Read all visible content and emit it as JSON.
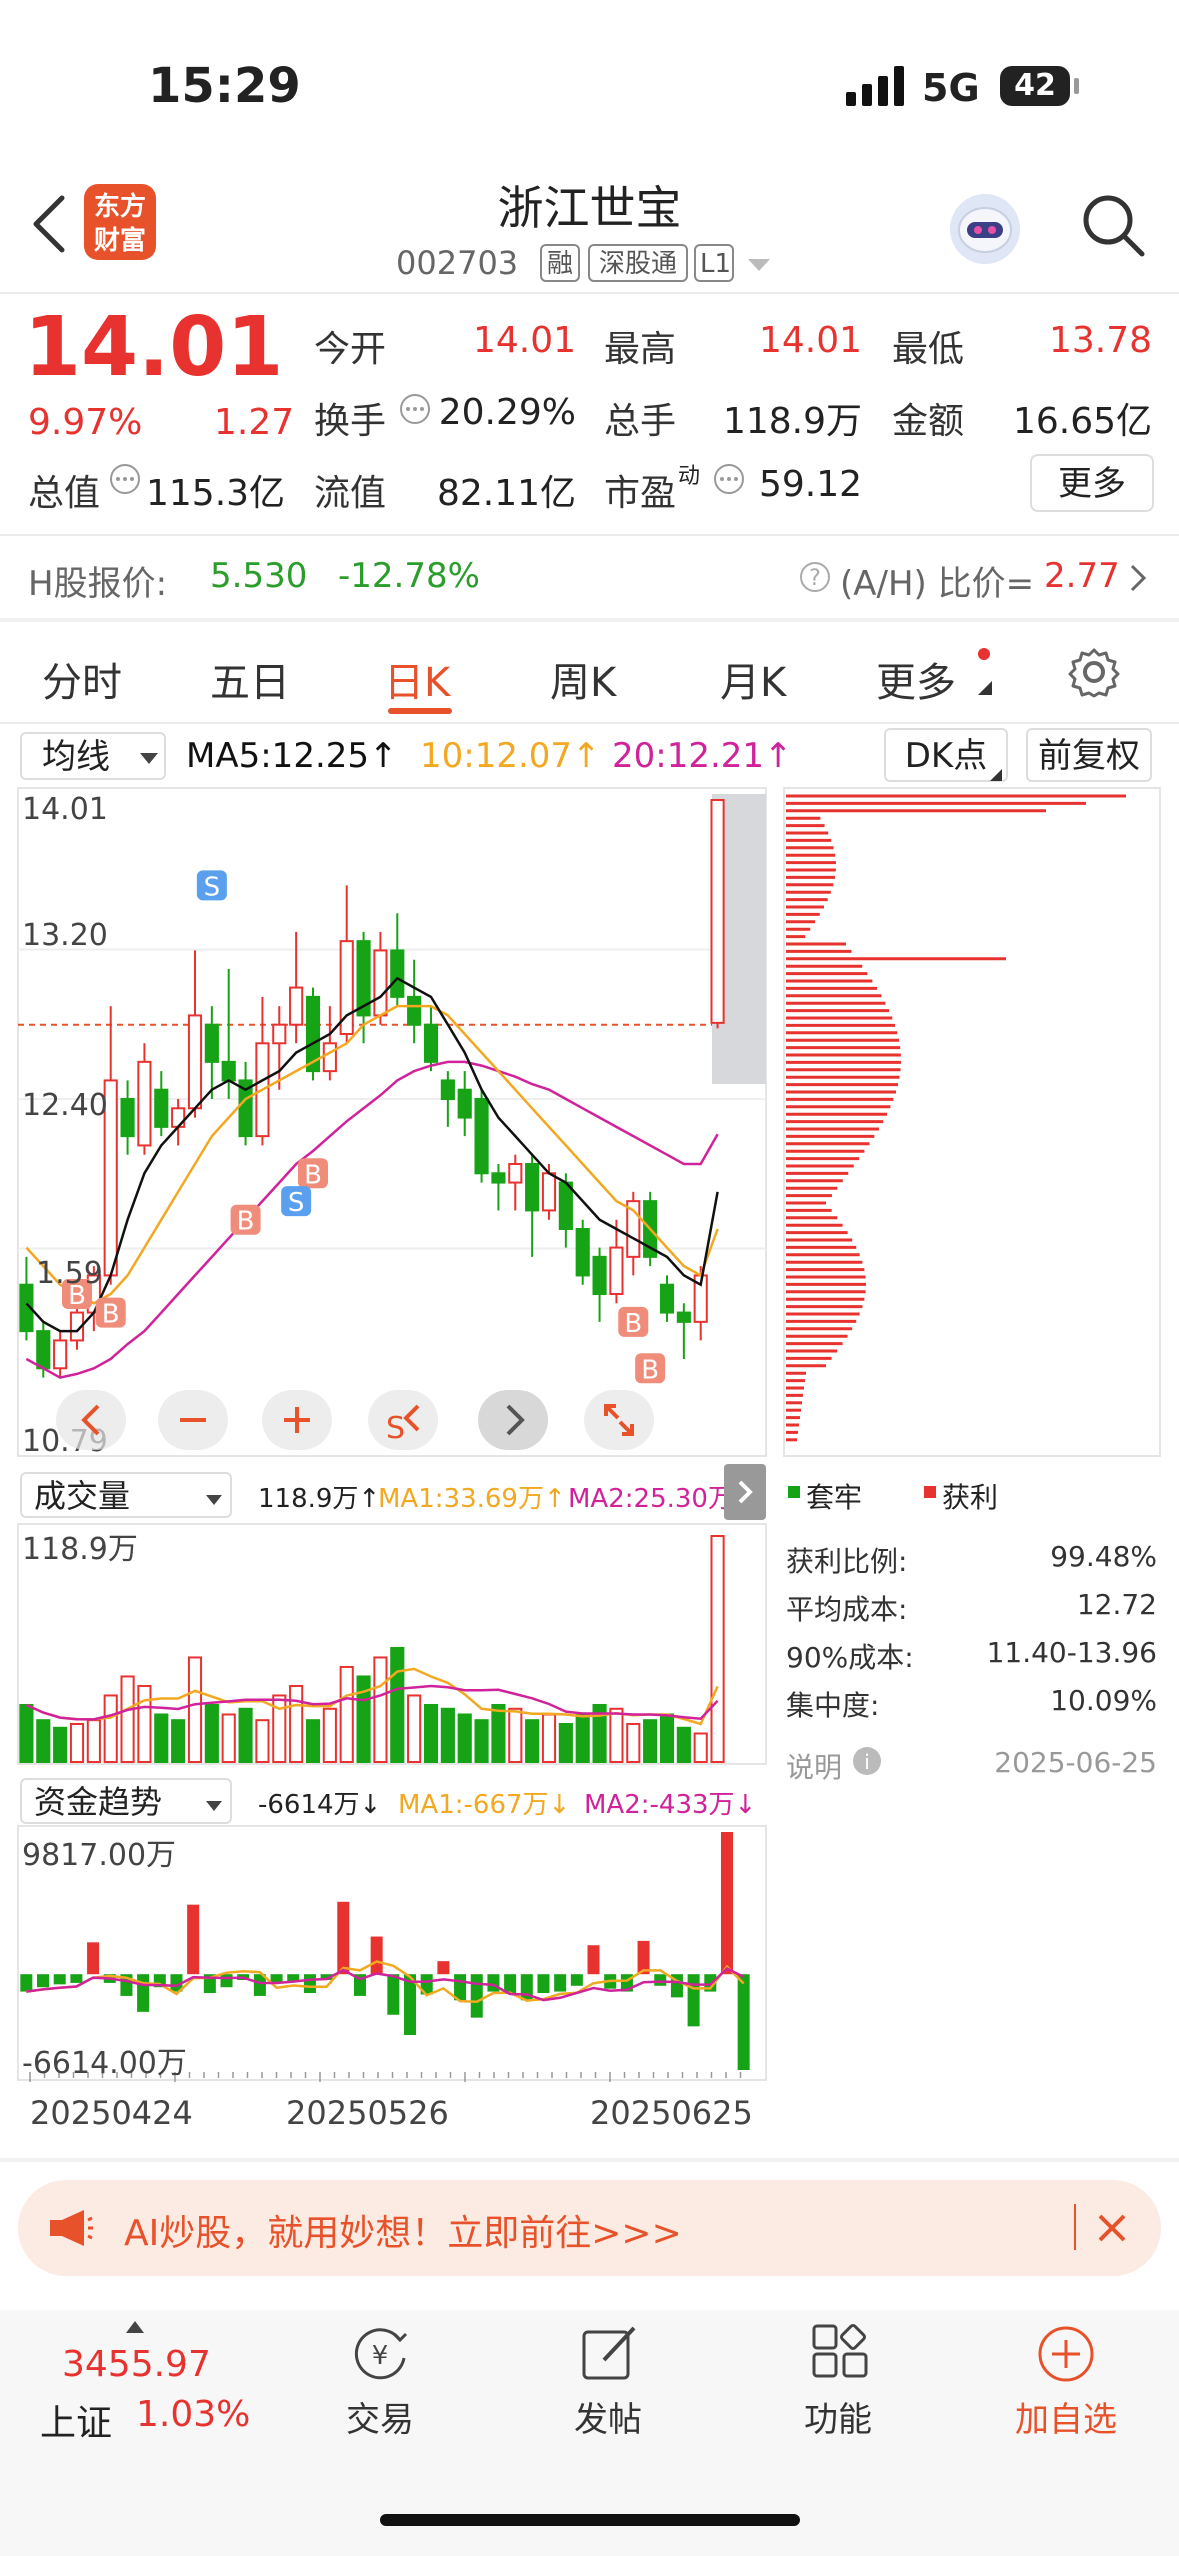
{
  "status_bar": {
    "time": "15:29",
    "network": "5G",
    "battery": "42"
  },
  "header": {
    "logo_text": "东方\n财富",
    "logo_line1": "东方",
    "logo_line2": "财富",
    "title": "浙江世宝",
    "code": "002703",
    "tags": [
      "融",
      "深股通",
      "L1"
    ]
  },
  "quote": {
    "price": "14.01",
    "change_pct": "9.97%",
    "change": "1.27",
    "rows": [
      [
        {
          "label": "今开",
          "value": "14.01",
          "color": "red"
        },
        {
          "label": "最高",
          "value": "14.01",
          "color": "red"
        },
        {
          "label": "最低",
          "value": "13.78",
          "color": "red"
        }
      ],
      [
        {
          "label": "换手",
          "value": "20.29%",
          "color": "dark"
        },
        {
          "label": "总手",
          "value": "118.9万",
          "color": "dark"
        },
        {
          "label": "金额",
          "value": "16.65亿",
          "color": "dark"
        }
      ],
      [
        {
          "label": "总值",
          "value": "115.3亿",
          "color": "dark"
        },
        {
          "label": "流值",
          "value": "82.11亿",
          "color": "dark"
        },
        {
          "label": "市盈",
          "value": "59.12",
          "color": "dark"
        }
      ]
    ],
    "pe_sup": "动",
    "more_label": "更多"
  },
  "hshare": {
    "label": "H股报价:",
    "price": "5.530",
    "pct": "-12.78%",
    "ratio_label": "(A/H) 比价=",
    "ratio": "2.77"
  },
  "tabs": [
    "分时",
    "五日",
    "日K",
    "周K",
    "月K",
    "更多"
  ],
  "active_tab": "日K",
  "ma_bar": {
    "selector": "均线",
    "ma5": "MA5:12.25↑",
    "ma10": "10:12.07↑",
    "ma20": "20:12.21↑",
    "dk": "DK点",
    "adjust": "前复权"
  },
  "colors": {
    "up": "#e8322f",
    "down": "#16a316",
    "ma5": "#111111",
    "ma10": "#f2a820",
    "ma20": "#d0229a",
    "accent": "#e8522a"
  },
  "chart_data": [
    {
      "type": "candlestick",
      "y_ticks": [
        "14.01",
        "13.20",
        "12.40",
        "1.59",
        "10.79"
      ],
      "ylim": [
        10.79,
        14.01
      ],
      "x_ticks": [
        "20250424",
        "20250526",
        "20250625"
      ],
      "candles": [
        [
          11.4,
          11.15,
          11.55,
          11.1
        ],
        [
          11.15,
          10.95,
          11.2,
          10.9
        ],
        [
          10.95,
          11.1,
          11.15,
          10.9
        ],
        [
          11.1,
          11.25,
          11.3,
          11.05
        ],
        [
          11.25,
          11.45,
          11.5,
          11.15
        ],
        [
          11.45,
          12.5,
          12.9,
          11.4
        ],
        [
          12.4,
          12.2,
          12.5,
          12.1
        ],
        [
          12.15,
          12.6,
          12.7,
          12.1
        ],
        [
          12.45,
          12.25,
          12.55,
          12.2
        ],
        [
          12.25,
          12.35,
          12.4,
          12.15
        ],
        [
          12.35,
          12.85,
          13.2,
          12.3
        ],
        [
          12.8,
          12.6,
          12.9,
          12.4
        ],
        [
          12.6,
          12.5,
          13.1,
          12.4
        ],
        [
          12.5,
          12.2,
          12.6,
          12.15
        ],
        [
          12.2,
          12.7,
          12.95,
          12.15
        ],
        [
          12.7,
          12.8,
          12.9,
          12.45
        ],
        [
          12.8,
          13.0,
          13.3,
          12.7
        ],
        [
          12.95,
          12.55,
          13.0,
          12.5
        ],
        [
          12.55,
          12.7,
          12.9,
          12.5
        ],
        [
          12.75,
          13.25,
          13.55,
          12.7
        ],
        [
          13.25,
          12.85,
          13.3,
          12.7
        ],
        [
          12.85,
          13.2,
          13.3,
          12.8
        ],
        [
          13.2,
          12.95,
          13.4,
          12.9
        ],
        [
          12.95,
          12.8,
          13.15,
          12.7
        ],
        [
          12.8,
          12.6,
          12.9,
          12.55
        ],
        [
          12.5,
          12.4,
          12.55,
          12.25
        ],
        [
          12.45,
          12.3,
          12.55,
          12.2
        ],
        [
          12.4,
          12.0,
          12.45,
          11.95
        ],
        [
          12.0,
          11.95,
          12.05,
          11.8
        ],
        [
          11.95,
          12.05,
          12.1,
          11.8
        ],
        [
          12.05,
          11.8,
          12.1,
          11.55
        ],
        [
          11.8,
          12.0,
          12.05,
          11.75
        ],
        [
          11.95,
          11.7,
          12.0,
          11.6
        ],
        [
          11.7,
          11.45,
          11.75,
          11.4
        ],
        [
          11.55,
          11.35,
          11.6,
          11.2
        ],
        [
          11.35,
          11.6,
          11.75,
          11.3
        ],
        [
          11.55,
          11.85,
          11.9,
          11.45
        ],
        [
          11.85,
          11.55,
          11.9,
          11.5
        ],
        [
          11.4,
          11.25,
          11.45,
          11.2
        ],
        [
          11.25,
          11.2,
          11.3,
          11.0
        ],
        [
          11.2,
          11.45,
          11.5,
          11.1
        ],
        [
          12.81,
          14.01,
          14.01,
          12.78
        ]
      ],
      "ma5": [
        11.3,
        11.2,
        11.15,
        11.15,
        11.25,
        11.45,
        11.75,
        12.0,
        12.15,
        12.25,
        12.35,
        12.45,
        12.5,
        12.45,
        12.5,
        12.55,
        12.65,
        12.7,
        12.75,
        12.85,
        12.9,
        12.95,
        13.05,
        13.0,
        12.95,
        12.8,
        12.65,
        12.45,
        12.3,
        12.2,
        12.1,
        12.0,
        11.95,
        11.85,
        11.75,
        11.7,
        11.65,
        11.6,
        11.55,
        11.45,
        11.4,
        11.9
      ],
      "ma10": [
        11.6,
        11.5,
        11.4,
        11.35,
        11.3,
        11.35,
        11.45,
        11.6,
        11.75,
        11.9,
        12.05,
        12.2,
        12.3,
        12.4,
        12.45,
        12.5,
        12.55,
        12.6,
        12.65,
        12.7,
        12.8,
        12.85,
        12.9,
        12.9,
        12.9,
        12.85,
        12.75,
        12.65,
        12.55,
        12.45,
        12.35,
        12.25,
        12.15,
        12.05,
        11.95,
        11.85,
        11.8,
        11.7,
        11.6,
        11.5,
        11.45,
        11.7
      ],
      "ma20": [
        11.0,
        10.95,
        10.9,
        10.92,
        10.95,
        11.0,
        11.08,
        11.15,
        11.25,
        11.35,
        11.45,
        11.55,
        11.65,
        11.75,
        11.85,
        11.95,
        12.05,
        12.12,
        12.2,
        12.28,
        12.35,
        12.42,
        12.5,
        12.55,
        12.58,
        12.6,
        12.6,
        12.58,
        12.55,
        12.52,
        12.48,
        12.45,
        12.4,
        12.35,
        12.3,
        12.25,
        12.2,
        12.15,
        12.1,
        12.05,
        12.05,
        12.21
      ]
    },
    {
      "type": "bar",
      "title": "成交量",
      "ylim": [
        0,
        118.9
      ],
      "values": [
        30,
        22,
        18,
        20,
        22,
        35,
        45,
        40,
        25,
        22,
        55,
        30,
        25,
        28,
        22,
        35,
        40,
        22,
        28,
        50,
        45,
        55,
        60,
        35,
        30,
        28,
        25,
        22,
        30,
        28,
        22,
        25,
        20,
        25,
        30,
        28,
        20,
        22,
        25,
        18,
        15,
        118.9
      ],
      "up": [
        0,
        0,
        0,
        1,
        1,
        1,
        1,
        1,
        0,
        0,
        1,
        0,
        1,
        0,
        1,
        1,
        1,
        0,
        1,
        1,
        0,
        1,
        0,
        1,
        0,
        0,
        0,
        0,
        0,
        1,
        0,
        1,
        0,
        0,
        0,
        1,
        1,
        0,
        0,
        0,
        1,
        1
      ]
    },
    {
      "type": "bar",
      "title": "资金趋势",
      "ylim": [
        -6614,
        9817
      ],
      "values": [
        -1200,
        -900,
        -700,
        -600,
        2200,
        -600,
        -1500,
        -2600,
        -900,
        -1200,
        4800,
        -1300,
        -900,
        -400,
        -1500,
        -600,
        -500,
        -1300,
        -400,
        5000,
        -1500,
        2600,
        -2800,
        -4200,
        -1400,
        900,
        -1800,
        -3000,
        -1200,
        -1300,
        -1800,
        -1300,
        -1200,
        -800,
        2000,
        -1000,
        -1200,
        2300,
        -800,
        -1600,
        -3600,
        -1200,
        9817,
        -6614
      ]
    }
  ],
  "vol_info": {
    "title": "成交量",
    "vol": "118.9万↑",
    "ma1": "MA1:33.69万↑",
    "ma2": "MA2:25.30万↑",
    "top_label": "118.9万"
  },
  "money_info": {
    "title": "资金趋势",
    "val": "-6614万↓",
    "ma1": "MA1:-667万↓",
    "ma2": "MA2:-433万↓",
    "top_label": "9817.00万",
    "bottom_label": "-6614.00万"
  },
  "chip": {
    "legend_trap": "套牢",
    "legend_profit": "获利",
    "stats": [
      {
        "label": "获利比例:",
        "value": "99.48%"
      },
      {
        "label": "平均成本:",
        "value": "12.72"
      },
      {
        "label": "90%成本:",
        "value": "11.40-13.96"
      },
      {
        "label": "集中度:",
        "value": "10.09%"
      }
    ],
    "note": "说明",
    "date": "2025-06-25"
  },
  "banner": {
    "text": "AI炒股，就用妙想！立即前往>>>"
  },
  "bottom_nav": {
    "index_value": "3455.97",
    "index_name": "上证",
    "index_pct": "1.03%",
    "items": [
      "交易",
      "发帖",
      "功能",
      "加自选"
    ]
  }
}
